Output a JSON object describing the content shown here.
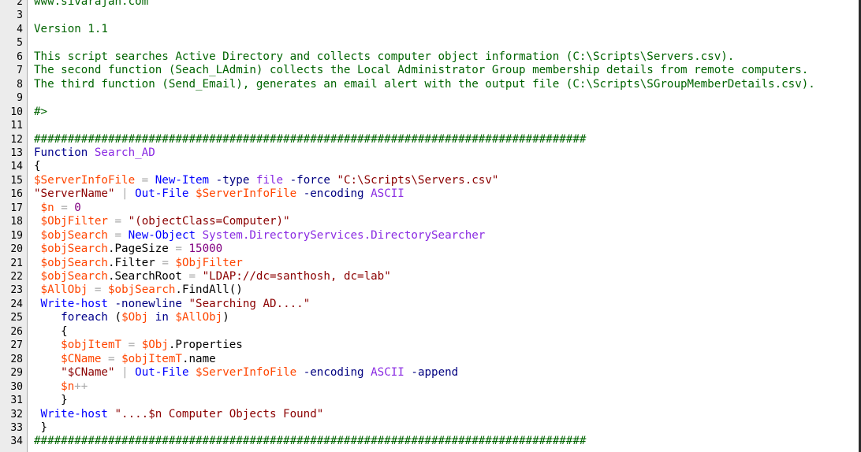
{
  "colors": {
    "comment": "#006400",
    "variable": "#ff4500",
    "keyword": "#00008b",
    "cmdlet": "#0000ff",
    "string": "#8b0000",
    "operator": "#a9a9a9",
    "type": "#8a2be2",
    "parameter": "#000080",
    "member": "#000000",
    "number": "#800080",
    "gutter_bg": "#ececec",
    "editor_bg": "#ffffff"
  },
  "lines": [
    {
      "n": "2",
      "tokens": [
        {
          "t": "comment",
          "v": "www.sivarajan.com"
        }
      ]
    },
    {
      "n": "3",
      "tokens": []
    },
    {
      "n": "4",
      "tokens": [
        {
          "t": "comment",
          "v": "Version 1.1"
        }
      ]
    },
    {
      "n": "5",
      "tokens": []
    },
    {
      "n": "6",
      "tokens": [
        {
          "t": "comment",
          "v": "This script searches Active Directory and collects computer object information (C:\\Scripts\\Servers.csv)."
        }
      ]
    },
    {
      "n": "7",
      "tokens": [
        {
          "t": "comment",
          "v": "The second function (Seach_LAdmin) collects the Local Administrator Group membership details from remote computers."
        }
      ]
    },
    {
      "n": "8",
      "tokens": [
        {
          "t": "comment",
          "v": "The third function (Send_Email), generates an email alert with the output file (C:\\Scripts\\SGroupMemberDetails.csv)."
        }
      ]
    },
    {
      "n": "9",
      "tokens": []
    },
    {
      "n": "10",
      "tokens": [
        {
          "t": "comment",
          "v": "#>"
        }
      ]
    },
    {
      "n": "11",
      "tokens": []
    },
    {
      "n": "12",
      "tokens": [
        {
          "t": "comment",
          "v": "##################################################################################"
        }
      ]
    },
    {
      "n": "13",
      "tokens": [
        {
          "t": "kw",
          "v": "Function"
        },
        {
          "t": "plain",
          "v": " "
        },
        {
          "t": "type",
          "v": "Search_AD"
        }
      ]
    },
    {
      "n": "14",
      "tokens": [
        {
          "t": "sym",
          "v": "{"
        }
      ]
    },
    {
      "n": "15",
      "tokens": [
        {
          "t": "var",
          "v": "$ServerInfoFile"
        },
        {
          "t": "plain",
          "v": " "
        },
        {
          "t": "op",
          "v": "="
        },
        {
          "t": "plain",
          "v": " "
        },
        {
          "t": "cmdlet",
          "v": "New-Item"
        },
        {
          "t": "plain",
          "v": " "
        },
        {
          "t": "param",
          "v": "-type"
        },
        {
          "t": "plain",
          "v": " "
        },
        {
          "t": "type",
          "v": "file"
        },
        {
          "t": "plain",
          "v": " "
        },
        {
          "t": "param",
          "v": "-force"
        },
        {
          "t": "plain",
          "v": " "
        },
        {
          "t": "str",
          "v": "\"C:\\Scripts\\Servers.csv\""
        }
      ]
    },
    {
      "n": "16",
      "tokens": [
        {
          "t": "str",
          "v": "\"ServerName\""
        },
        {
          "t": "plain",
          "v": " "
        },
        {
          "t": "op",
          "v": "|"
        },
        {
          "t": "plain",
          "v": " "
        },
        {
          "t": "cmdlet",
          "v": "Out-File"
        },
        {
          "t": "plain",
          "v": " "
        },
        {
          "t": "var",
          "v": "$ServerInfoFile"
        },
        {
          "t": "plain",
          "v": " "
        },
        {
          "t": "param",
          "v": "-encoding"
        },
        {
          "t": "plain",
          "v": " "
        },
        {
          "t": "type",
          "v": "ASCII"
        }
      ]
    },
    {
      "n": "17",
      "tokens": [
        {
          "t": "plain",
          "v": " "
        },
        {
          "t": "var",
          "v": "$n"
        },
        {
          "t": "plain",
          "v": " "
        },
        {
          "t": "op",
          "v": "="
        },
        {
          "t": "plain",
          "v": " "
        },
        {
          "t": "num",
          "v": "0"
        }
      ]
    },
    {
      "n": "18",
      "tokens": [
        {
          "t": "plain",
          "v": " "
        },
        {
          "t": "var",
          "v": "$ObjFilter"
        },
        {
          "t": "plain",
          "v": " "
        },
        {
          "t": "op",
          "v": "="
        },
        {
          "t": "plain",
          "v": " "
        },
        {
          "t": "str",
          "v": "\"(objectClass=Computer)\""
        }
      ]
    },
    {
      "n": "19",
      "tokens": [
        {
          "t": "plain",
          "v": " "
        },
        {
          "t": "var",
          "v": "$objSearch"
        },
        {
          "t": "plain",
          "v": " "
        },
        {
          "t": "op",
          "v": "="
        },
        {
          "t": "plain",
          "v": " "
        },
        {
          "t": "cmdlet",
          "v": "New-Object"
        },
        {
          "t": "plain",
          "v": " "
        },
        {
          "t": "type",
          "v": "System.DirectoryServices.DirectorySearcher"
        }
      ]
    },
    {
      "n": "20",
      "tokens": [
        {
          "t": "plain",
          "v": " "
        },
        {
          "t": "var",
          "v": "$objSearch"
        },
        {
          "t": "sym",
          "v": "."
        },
        {
          "t": "member",
          "v": "PageSize"
        },
        {
          "t": "plain",
          "v": " "
        },
        {
          "t": "op",
          "v": "="
        },
        {
          "t": "plain",
          "v": " "
        },
        {
          "t": "num",
          "v": "15000"
        }
      ]
    },
    {
      "n": "21",
      "tokens": [
        {
          "t": "plain",
          "v": " "
        },
        {
          "t": "var",
          "v": "$objSearch"
        },
        {
          "t": "sym",
          "v": "."
        },
        {
          "t": "member",
          "v": "Filter"
        },
        {
          "t": "plain",
          "v": " "
        },
        {
          "t": "op",
          "v": "="
        },
        {
          "t": "plain",
          "v": " "
        },
        {
          "t": "var",
          "v": "$ObjFilter"
        }
      ]
    },
    {
      "n": "22",
      "tokens": [
        {
          "t": "plain",
          "v": " "
        },
        {
          "t": "var",
          "v": "$objSearch"
        },
        {
          "t": "sym",
          "v": "."
        },
        {
          "t": "member",
          "v": "SearchRoot"
        },
        {
          "t": "plain",
          "v": " "
        },
        {
          "t": "op",
          "v": "="
        },
        {
          "t": "plain",
          "v": " "
        },
        {
          "t": "str",
          "v": "\"LDAP://dc=santhosh, dc=lab\""
        }
      ]
    },
    {
      "n": "23",
      "tokens": [
        {
          "t": "plain",
          "v": " "
        },
        {
          "t": "var",
          "v": "$AllObj"
        },
        {
          "t": "plain",
          "v": " "
        },
        {
          "t": "op",
          "v": "="
        },
        {
          "t": "plain",
          "v": " "
        },
        {
          "t": "var",
          "v": "$objSearch"
        },
        {
          "t": "sym",
          "v": "."
        },
        {
          "t": "member",
          "v": "FindAll"
        },
        {
          "t": "sym",
          "v": "()"
        }
      ]
    },
    {
      "n": "24",
      "tokens": [
        {
          "t": "plain",
          "v": " "
        },
        {
          "t": "cmdlet",
          "v": "Write-host"
        },
        {
          "t": "plain",
          "v": " "
        },
        {
          "t": "param",
          "v": "-nonewline"
        },
        {
          "t": "plain",
          "v": " "
        },
        {
          "t": "str",
          "v": "\"Searching AD....\""
        }
      ]
    },
    {
      "n": "25",
      "tokens": [
        {
          "t": "plain",
          "v": "    "
        },
        {
          "t": "kw",
          "v": "foreach"
        },
        {
          "t": "plain",
          "v": " "
        },
        {
          "t": "sym",
          "v": "("
        },
        {
          "t": "var",
          "v": "$Obj"
        },
        {
          "t": "plain",
          "v": " "
        },
        {
          "t": "kw",
          "v": "in"
        },
        {
          "t": "plain",
          "v": " "
        },
        {
          "t": "var",
          "v": "$AllObj"
        },
        {
          "t": "sym",
          "v": ")"
        }
      ]
    },
    {
      "n": "26",
      "tokens": [
        {
          "t": "plain",
          "v": "    "
        },
        {
          "t": "sym",
          "v": "{"
        }
      ]
    },
    {
      "n": "27",
      "tokens": [
        {
          "t": "plain",
          "v": "    "
        },
        {
          "t": "var",
          "v": "$objItemT"
        },
        {
          "t": "plain",
          "v": " "
        },
        {
          "t": "op",
          "v": "="
        },
        {
          "t": "plain",
          "v": " "
        },
        {
          "t": "var",
          "v": "$Obj"
        },
        {
          "t": "sym",
          "v": "."
        },
        {
          "t": "member",
          "v": "Properties"
        }
      ]
    },
    {
      "n": "28",
      "tokens": [
        {
          "t": "plain",
          "v": "    "
        },
        {
          "t": "var",
          "v": "$CName"
        },
        {
          "t": "plain",
          "v": " "
        },
        {
          "t": "op",
          "v": "="
        },
        {
          "t": "plain",
          "v": " "
        },
        {
          "t": "var",
          "v": "$objItemT"
        },
        {
          "t": "sym",
          "v": "."
        },
        {
          "t": "member",
          "v": "name"
        }
      ]
    },
    {
      "n": "29",
      "tokens": [
        {
          "t": "plain",
          "v": "    "
        },
        {
          "t": "str",
          "v": "\"$CName\""
        },
        {
          "t": "plain",
          "v": " "
        },
        {
          "t": "op",
          "v": "|"
        },
        {
          "t": "plain",
          "v": " "
        },
        {
          "t": "cmdlet",
          "v": "Out-File"
        },
        {
          "t": "plain",
          "v": " "
        },
        {
          "t": "var",
          "v": "$ServerInfoFile"
        },
        {
          "t": "plain",
          "v": " "
        },
        {
          "t": "param",
          "v": "-encoding"
        },
        {
          "t": "plain",
          "v": " "
        },
        {
          "t": "type",
          "v": "ASCII"
        },
        {
          "t": "plain",
          "v": " "
        },
        {
          "t": "param",
          "v": "-append"
        }
      ]
    },
    {
      "n": "30",
      "tokens": [
        {
          "t": "plain",
          "v": "    "
        },
        {
          "t": "var",
          "v": "$n"
        },
        {
          "t": "op",
          "v": "++"
        }
      ]
    },
    {
      "n": "31",
      "tokens": [
        {
          "t": "plain",
          "v": "    "
        },
        {
          "t": "sym",
          "v": "}"
        }
      ]
    },
    {
      "n": "32",
      "tokens": [
        {
          "t": "plain",
          "v": " "
        },
        {
          "t": "cmdlet",
          "v": "Write-host"
        },
        {
          "t": "plain",
          "v": " "
        },
        {
          "t": "str",
          "v": "\"....$n Computer Objects Found\""
        }
      ]
    },
    {
      "n": "33",
      "tokens": [
        {
          "t": "plain",
          "v": " "
        },
        {
          "t": "sym",
          "v": "}"
        }
      ]
    },
    {
      "n": "34",
      "tokens": [
        {
          "t": "comment",
          "v": "##################################################################################"
        }
      ]
    }
  ]
}
